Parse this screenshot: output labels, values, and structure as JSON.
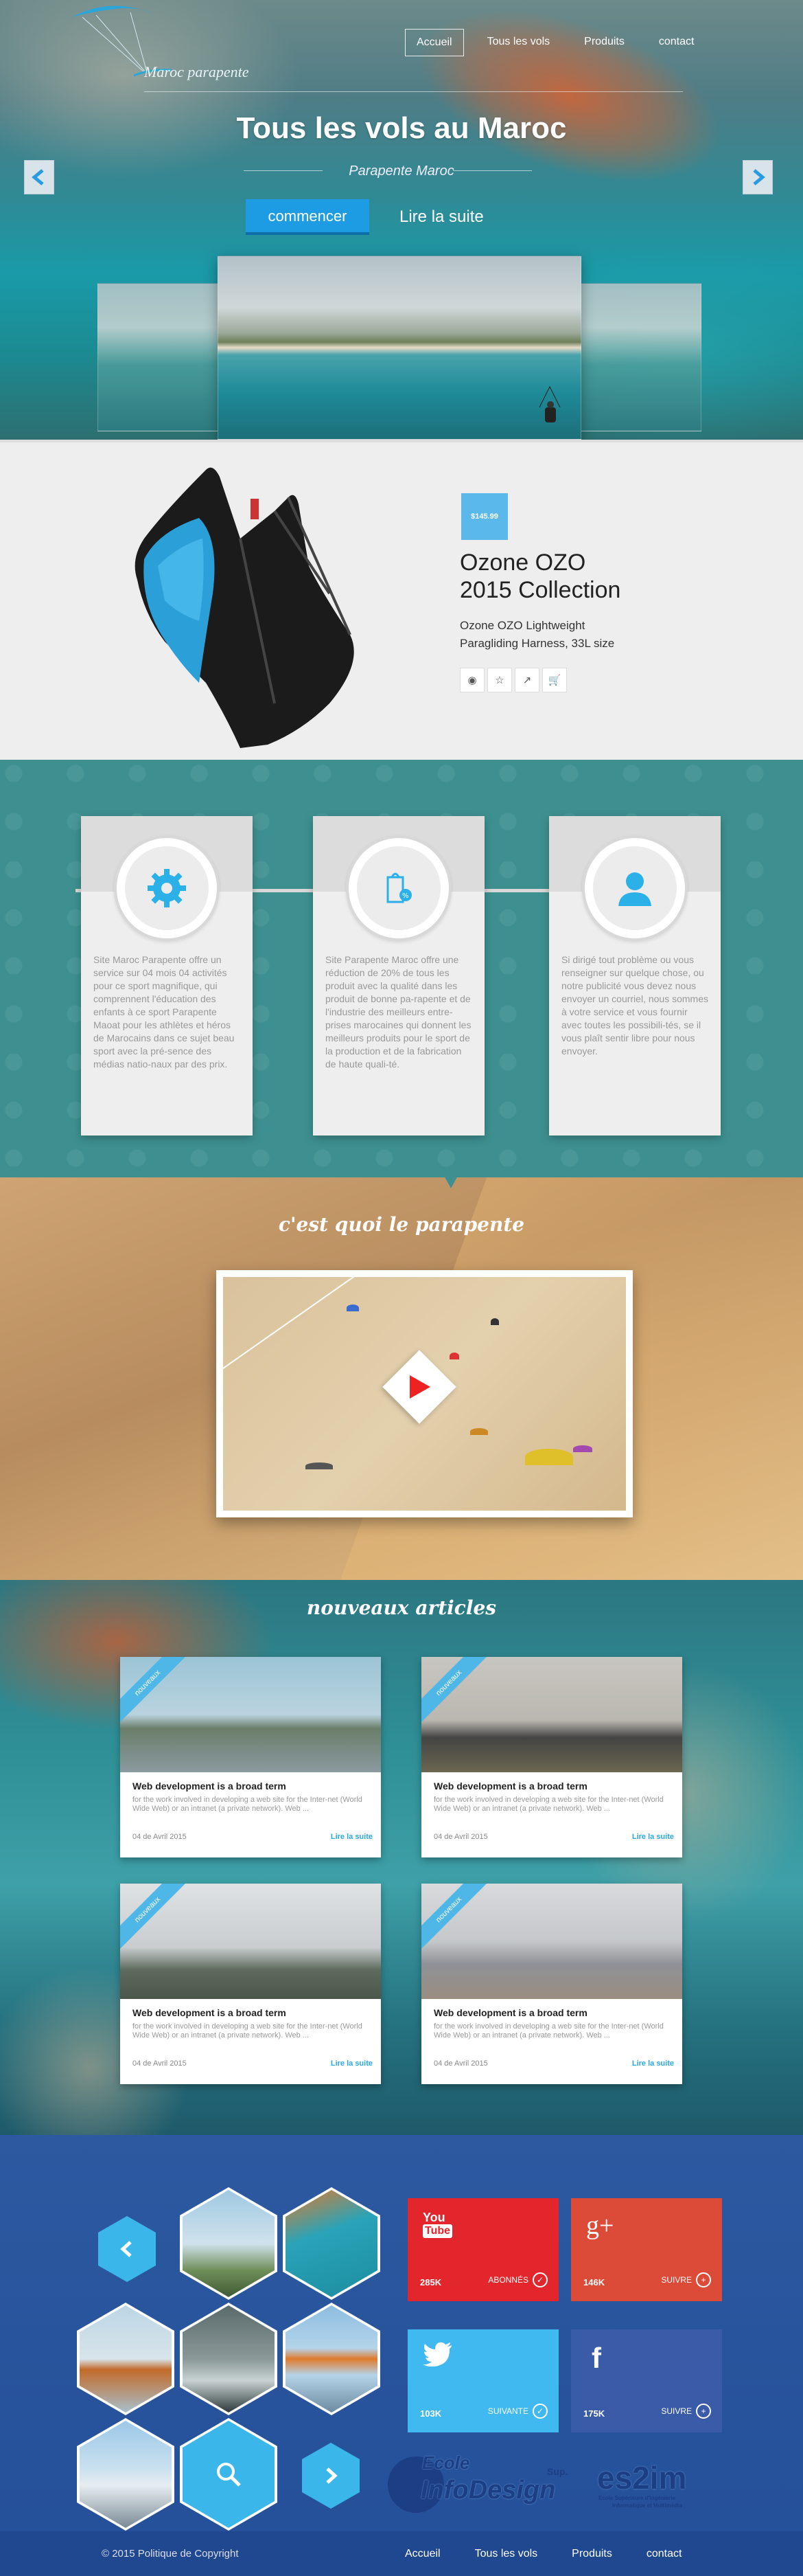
{
  "header": {
    "logo_text": "Maroc parapente",
    "nav": [
      {
        "label": "Accueil",
        "active": true
      },
      {
        "label": "Tous les vols"
      },
      {
        "label": "Produits"
      },
      {
        "label": "contact"
      }
    ]
  },
  "hero": {
    "title": "Tous les vols au Maroc",
    "subtitle": "Parapente  Maroc",
    "primary_button": "commencer",
    "secondary_button": "Lire la suite"
  },
  "product": {
    "price": "$145.99",
    "title_line1": "Ozone OZO",
    "title_line2": "2015 Collection",
    "description": "Ozone OZO Lightweight Paragliding Harness, 33L size",
    "actions": [
      "eye-icon",
      "star-icon",
      "share-icon",
      "cart-icon"
    ]
  },
  "features": [
    {
      "icon": "gear-icon",
      "text": "Site Maroc Parapente offre un service sur 04 mois 04 activités pour ce sport magnifique, qui comprennent l'éducation des enfants à ce sport Parapente Maoat pour les athlètes et héros de Marocains dans ce sujet beau sport avec la pré-sence des médias natio-naux par des prix."
    },
    {
      "icon": "discount-tag-icon",
      "text": "Site Parapente Maroc offre une réduction de 20% de tous les produit avec la qualité dans les produit de bonne pa-rapente et de l'industrie des meilleurs entre-prises marocaines qui donnent les meilleurs produits pour le sport de la production et de la fabrication de haute quali-té."
    },
    {
      "icon": "user-icon",
      "text": "Si dirigé tout problème ou vous renseigner sur quelque chose, ou notre publicité vous devez nous envoyer un courriel, nous sommes à votre service et vous fournir avec toutes les possibili-tés, se il vous plaît sentir libre pour nous envoyer."
    }
  ],
  "video": {
    "title": "c'est quoi le parapente"
  },
  "articles": {
    "title": "nouveaux articles",
    "items": [
      {
        "ribbon": "nouveaux",
        "title": "Web development is a broad term",
        "desc": "for the work involved in developing a web site for the Inter-net (World Wide Web) or an intranet (a private network). Web ...",
        "date": "04 de Avril 2015",
        "more": "Lire la suite"
      },
      {
        "ribbon": "nouveaux",
        "title": "Web development is a broad term",
        "desc": "for the work involved in developing a web site for the Inter-net (World Wide Web) or an intranet (a private network). Web ...",
        "date": "04 de Avril 2015",
        "more": "Lire la suite"
      },
      {
        "ribbon": "nouveaux",
        "title": "Web development is a broad term",
        "desc": "for the work involved in developing a web site for the Inter-net (World Wide Web) or an intranet (a private network). Web ...",
        "date": "04 de Avril 2015",
        "more": "Lire la suite"
      },
      {
        "ribbon": "nouveaux",
        "title": "Web development is a broad term",
        "desc": "for the work involved in developing a web site for the Inter-net (World Wide Web) or an intranet (a private network). Web ...",
        "date": "04 de Avril 2015",
        "more": "Lire la suite"
      }
    ]
  },
  "social": {
    "youtube": {
      "glyph_line1": "You",
      "glyph_line2": "Tube",
      "count": "285K",
      "action": "ABONNÉS",
      "color": "#e3262b"
    },
    "googleplus": {
      "glyph": "g+",
      "count": "146K",
      "action": "SUIVRE",
      "color": "#dc4a38"
    },
    "twitter": {
      "glyph": "twitter-bird",
      "count": "103K",
      "action": "SUIVANTE",
      "color": "#3fb9ef"
    },
    "facebook": {
      "glyph": "f",
      "count": "175K",
      "action": "SUIVRE",
      "color": "#3a5ba8"
    },
    "logo1_line1": "Ecole",
    "logo1_sup": "Sup.",
    "logo1_line2": "InfoDesign",
    "logo2_line1": "es2im",
    "logo2_line2": "Ecole Supérieure d'Ingénierie",
    "logo2_line3": "Informatique et Multimédia"
  },
  "footer": {
    "copyright": "© 2015 Politique de Copyright",
    "nav": [
      "Accueil",
      "Tous les vols",
      "Produits",
      "contact"
    ]
  },
  "colors": {
    "accent_blue": "#1d9be3",
    "teal_section": "#3e9090",
    "social_bg": "#2c59a0"
  }
}
